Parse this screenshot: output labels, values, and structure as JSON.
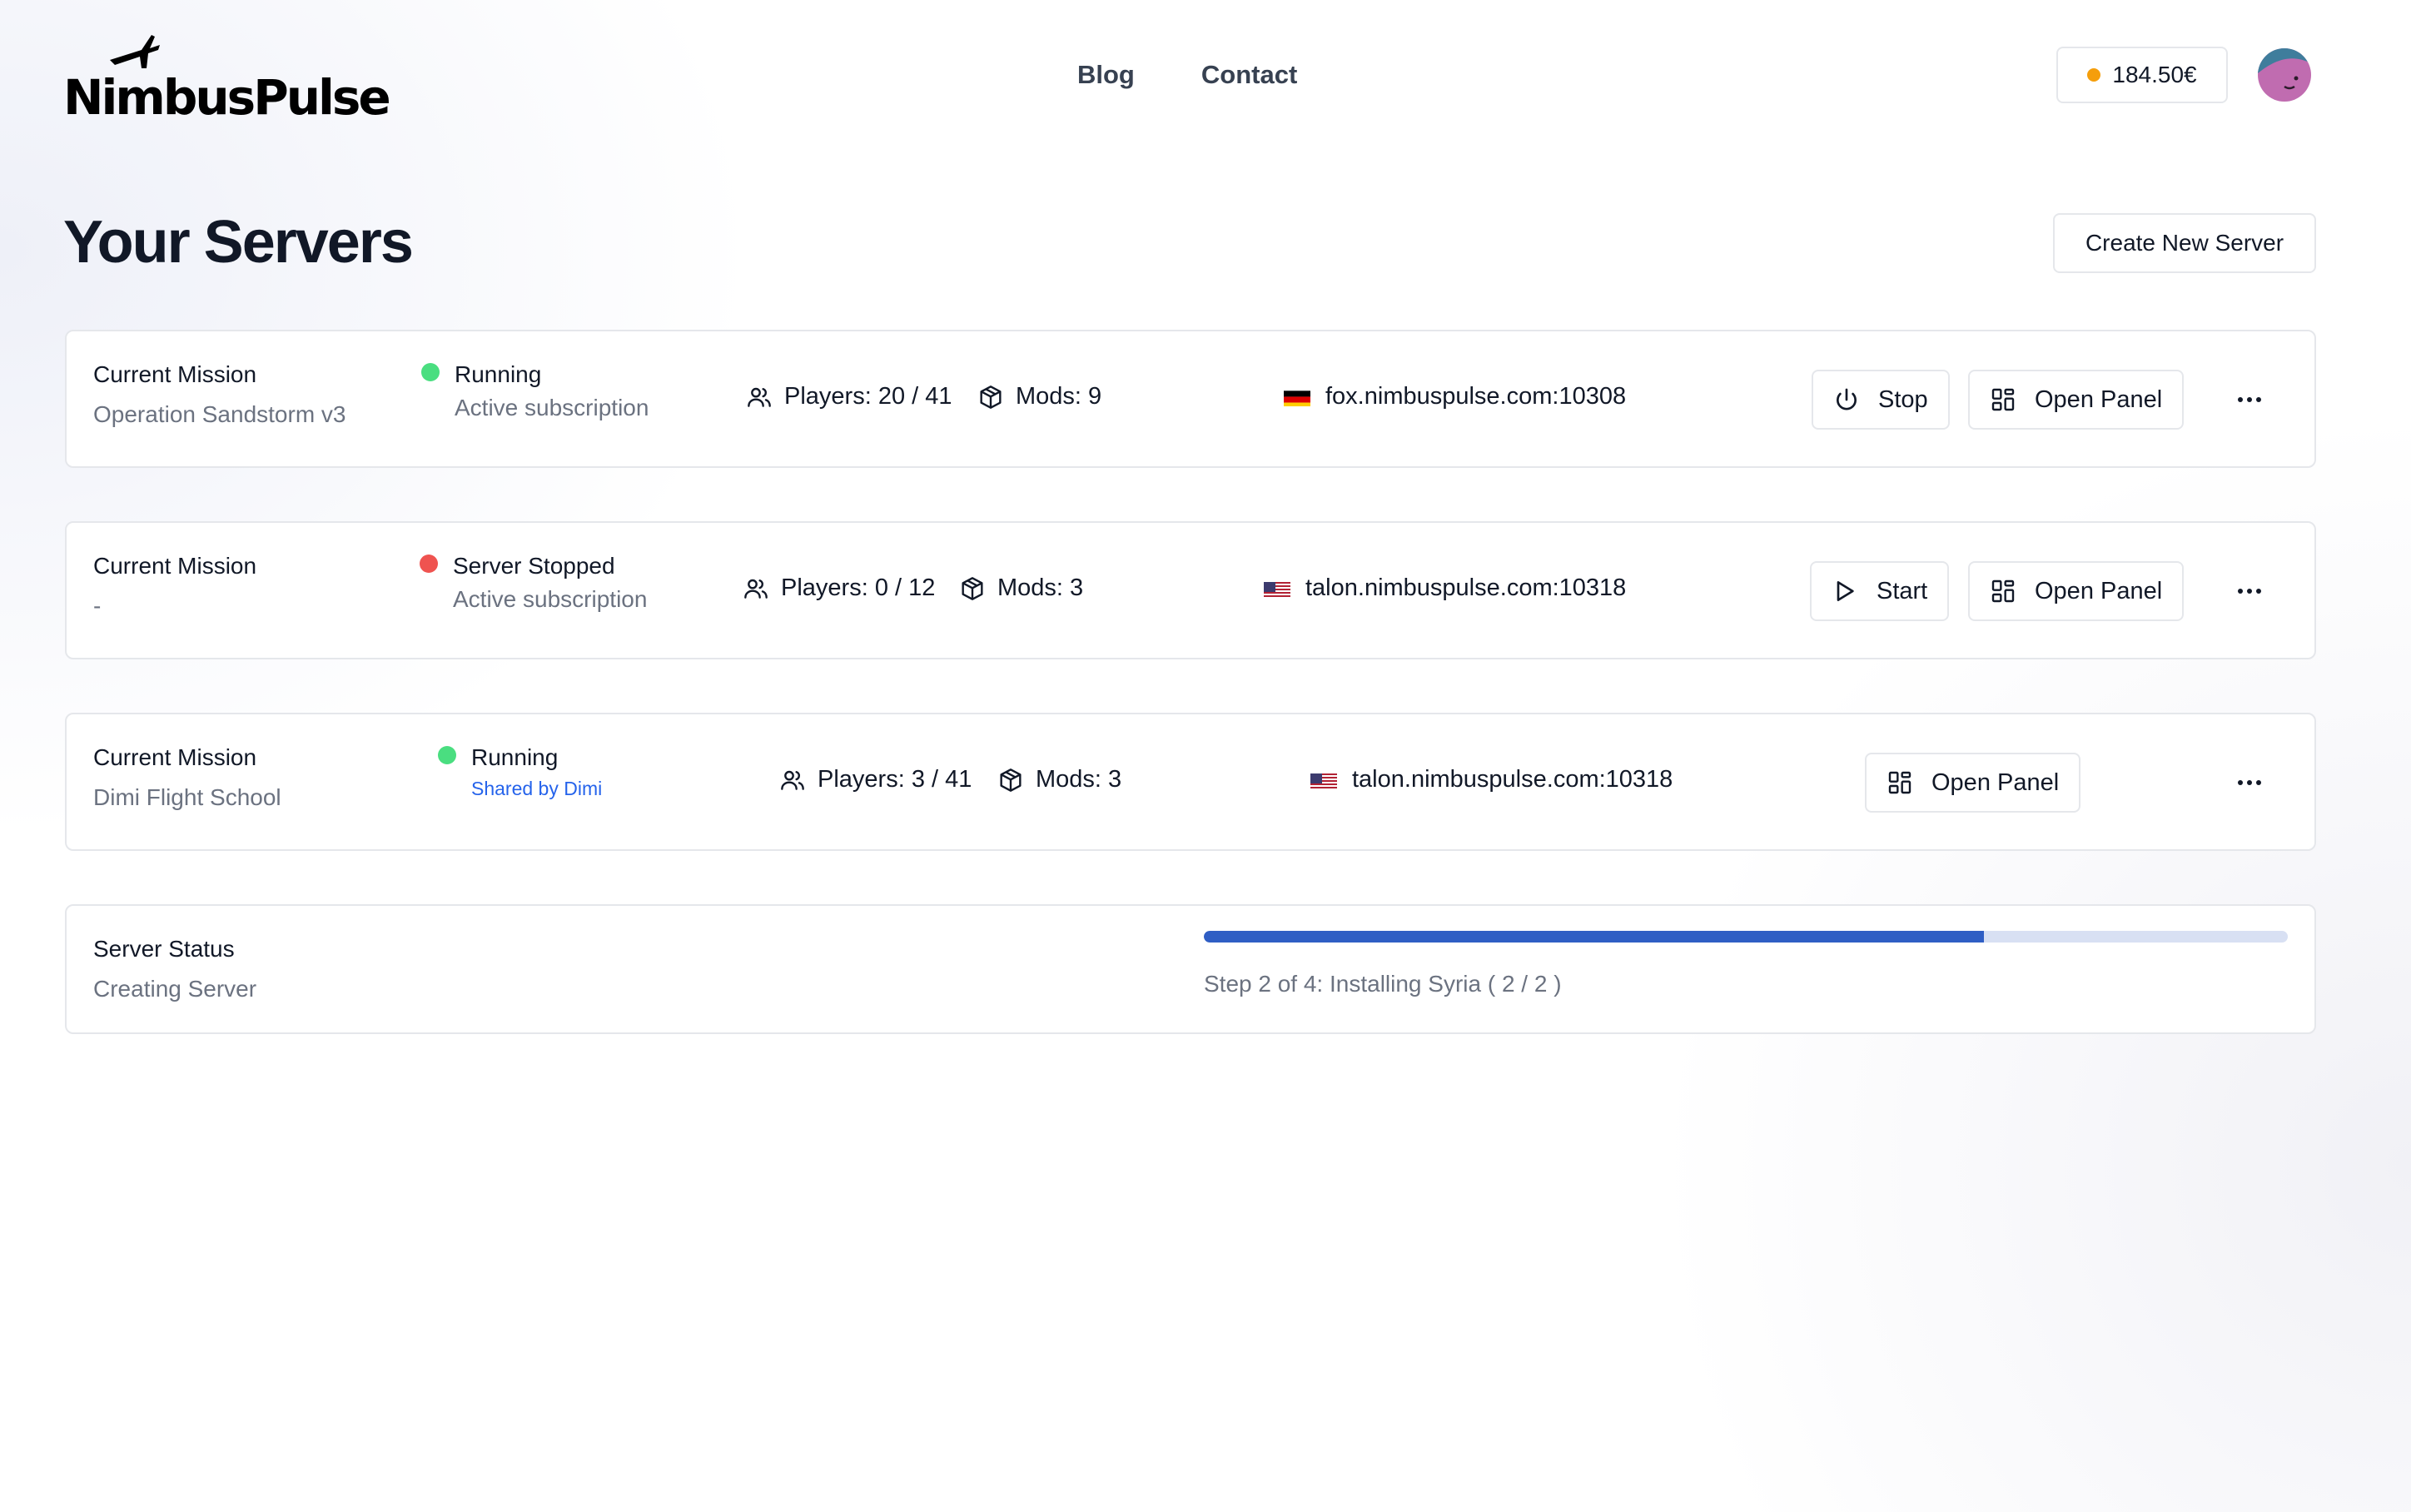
{
  "brand": {
    "logo_text": "NimbusPulse"
  },
  "nav": {
    "items": [
      {
        "label": "Blog"
      },
      {
        "label": "Contact"
      }
    ]
  },
  "account": {
    "balance": "184.50€",
    "balance_dot_color": "#f59e0b"
  },
  "page": {
    "title": "Your Servers",
    "create_button": "Create New Server"
  },
  "servers": [
    {
      "mission_label": "Current Mission",
      "mission_value": "Operation Sandstorm v3",
      "status": "Running",
      "status_color": "#4ade80",
      "subscription": "Active subscription",
      "players": "Players: 20 / 41",
      "mods": "Mods: 9",
      "address": "fox.nimbuspulse.com:10308",
      "flag": "germany-flag",
      "action_label": "Stop",
      "action_icon": "power-icon",
      "panel_label": "Open Panel"
    },
    {
      "mission_label": "Current Mission",
      "mission_value": "-",
      "status": "Server Stopped",
      "status_color": "#ef5350",
      "subscription": "Active subscription",
      "players": "Players: 0 / 12",
      "mods": "Mods: 3",
      "address": "talon.nimbuspulse.com:10318",
      "flag": "usa-flag",
      "action_label": "Start",
      "action_icon": "play-icon",
      "panel_label": "Open Panel"
    },
    {
      "mission_label": "Current Mission",
      "mission_value": "Dimi Flight School",
      "status": "Running",
      "status_color": "#4ade80",
      "shared_by": "Shared by Dimi",
      "players": "Players: 3 / 41",
      "mods": "Mods: 3",
      "address": "talon.nimbuspulse.com:10318",
      "flag": "usa-flag",
      "panel_label": "Open Panel"
    }
  ],
  "creation": {
    "label": "Server Status",
    "value": "Creating Server",
    "progress_fraction": 0.72,
    "step_text": "Step 2 of 4: Installing Syria ( 2 / 2 )",
    "fill_color": "#2f5ec4"
  }
}
